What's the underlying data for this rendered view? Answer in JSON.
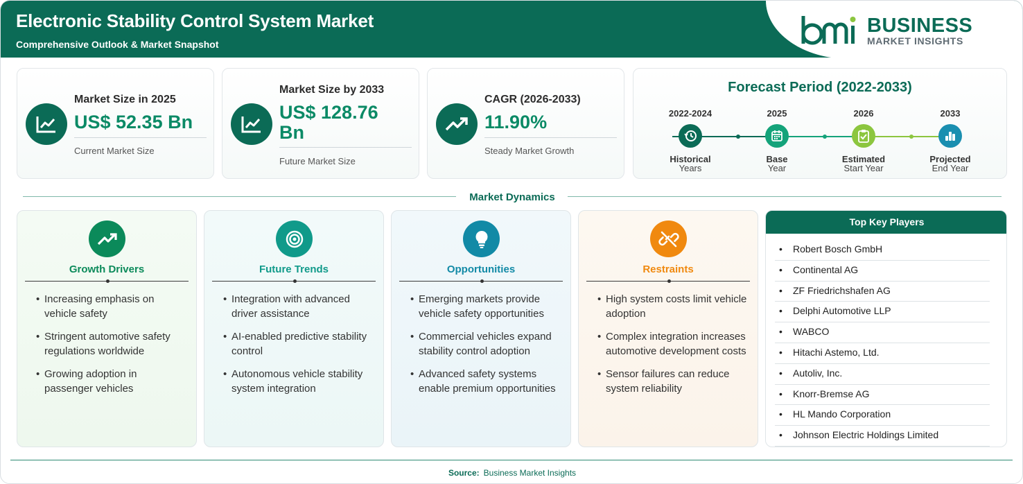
{
  "header": {
    "title": "Electronic Stability Control System Market",
    "subtitle": "Comprehensive Outlook & Market Snapshot",
    "logo_line1": "BUSINESS",
    "logo_line2": "MARKET INSIGHTS",
    "logo_mark": "bmi"
  },
  "stats": [
    {
      "label": "Market Size in 2025",
      "value": "US$ 52.35 Bn",
      "note": "Current Market Size",
      "icon": "line-chart-icon"
    },
    {
      "label": "Market Size by 2033",
      "value": "US$ 128.76 Bn",
      "note": "Future Market Size",
      "icon": "line-chart-icon"
    },
    {
      "label": "CAGR (2026-2033)",
      "value": "11.90%",
      "note": "Steady Market Growth",
      "icon": "trending-up-icon"
    }
  ],
  "forecast": {
    "title": "Forecast Period (2022-2033)",
    "steps": [
      {
        "year": "2022-2024",
        "caption1": "Historical",
        "caption2": "Years",
        "icon": "history-icon",
        "color": "#0b6b56"
      },
      {
        "year": "2025",
        "caption1": "Base",
        "caption2": "Year",
        "icon": "calendar-icon",
        "color": "#14a37a"
      },
      {
        "year": "2026",
        "caption1": "Estimated",
        "caption2": "Start Year",
        "icon": "clipboard-check-icon",
        "color": "#8cc63f"
      },
      {
        "year": "2033",
        "caption1": "Projected",
        "caption2": "End Year",
        "icon": "bar-chart-icon",
        "color": "#1a8fb0"
      }
    ]
  },
  "dynamics": {
    "title": "Market Dynamics",
    "columns": [
      {
        "title": "Growth Drivers",
        "color": "#0b8a5a",
        "icon": "trending-up-icon",
        "items": [
          "Increasing emphasis on vehicle safety",
          "Stringent automotive safety regulations worldwide",
          "Growing adoption in passenger vehicles"
        ]
      },
      {
        "title": "Future Trends",
        "color": "#109a8a",
        "icon": "target-icon",
        "items": [
          "Integration with advanced driver assistance",
          "AI-enabled predictive stability control",
          "Autonomous vehicle stability system integration"
        ]
      },
      {
        "title": "Opportunities",
        "color": "#128aa6",
        "icon": "lightbulb-icon",
        "items": [
          "Emerging markets provide vehicle safety opportunities",
          "Commercial vehicles expand stability control adoption",
          "Advanced safety systems enable premium opportunities"
        ]
      },
      {
        "title": "Restraints",
        "color": "#f0890f",
        "icon": "broken-link-icon",
        "items": [
          "High system costs limit vehicle adoption",
          "Complex integration increases automotive development costs",
          "Sensor failures can reduce system reliability"
        ]
      }
    ]
  },
  "key_players": {
    "title": "Top Key Players",
    "items": [
      "Robert Bosch GmbH",
      "Continental AG",
      "ZF Friedrichshafen AG",
      "Delphi Automotive LLP",
      "WABCO",
      "Hitachi Astemo, Ltd.",
      "Autoliv, Inc.",
      "Knorr-Bremse AG",
      "HL Mando Corporation",
      "Johnson Electric Holdings Limited"
    ]
  },
  "footer": {
    "source_label": "Source:",
    "source_value": "Business Market Insights"
  }
}
